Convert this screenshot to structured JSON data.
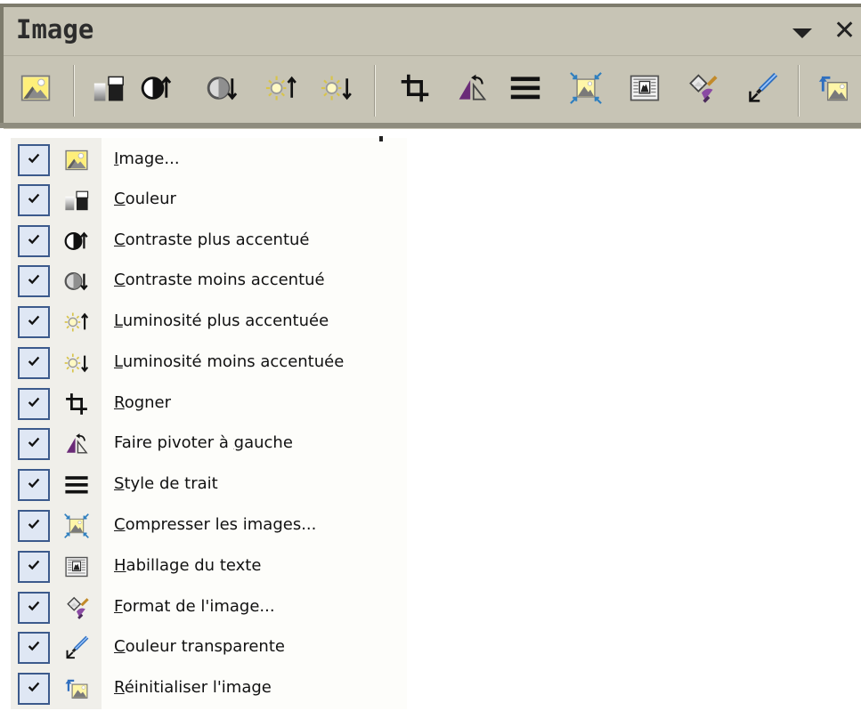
{
  "toolbar": {
    "title": "Image",
    "buttons": [
      {
        "name": "image-icon"
      },
      {
        "name": "color-icon"
      },
      {
        "name": "more-contrast-icon"
      },
      {
        "name": "less-contrast-icon"
      },
      {
        "name": "more-brightness-icon"
      },
      {
        "name": "less-brightness-icon"
      },
      {
        "name": "crop-icon"
      },
      {
        "name": "rotate-left-icon"
      },
      {
        "name": "line-style-icon"
      },
      {
        "name": "compress-images-icon"
      },
      {
        "name": "text-wrapping-icon"
      },
      {
        "name": "format-picture-icon"
      },
      {
        "name": "set-transparent-color-icon"
      },
      {
        "name": "reset-picture-icon"
      }
    ]
  },
  "menu": {
    "items": [
      {
        "mnemonic": "I",
        "rest": "mage...",
        "icon": "image-icon",
        "checked": true
      },
      {
        "mnemonic": "C",
        "rest": "ouleur",
        "icon": "color-icon",
        "checked": true
      },
      {
        "mnemonic": "C",
        "rest": "ontraste plus accentué",
        "icon": "more-contrast-icon",
        "checked": true
      },
      {
        "mnemonic": "C",
        "rest": "ontraste moins accentué",
        "icon": "less-contrast-icon",
        "checked": true
      },
      {
        "mnemonic": "L",
        "rest": "uminosité plus accentuée",
        "icon": "more-brightness-icon",
        "checked": true
      },
      {
        "mnemonic": "L",
        "rest": "uminosité moins accentuée",
        "icon": "less-brightness-icon",
        "checked": true
      },
      {
        "mnemonic": "R",
        "rest": "ogner",
        "icon": "crop-icon",
        "checked": true
      },
      {
        "prefix": "Faire pivoter à ",
        "mnemonic": "g",
        "rest": "auche",
        "icon": "rotate-left-icon",
        "checked": true
      },
      {
        "mnemonic": "S",
        "rest": "tyle de trait",
        "icon": "line-style-icon",
        "checked": true
      },
      {
        "mnemonic": "C",
        "rest": "ompresser les images...",
        "icon": "compress-images-icon",
        "checked": true
      },
      {
        "mnemonic": "H",
        "rest": "abillage du texte",
        "icon": "text-wrapping-icon",
        "checked": true
      },
      {
        "mnemonic": "F",
        "rest": "ormat de l'image...",
        "icon": "format-picture-icon",
        "checked": true
      },
      {
        "mnemonic": "C",
        "rest": "ouleur transparente",
        "icon": "set-transparent-color-icon",
        "checked": true
      },
      {
        "mnemonic": "R",
        "rest": "éinitialiser l'image",
        "icon": "reset-picture-icon",
        "checked": true
      }
    ]
  },
  "colors": {
    "toolbar_bg": "#c7c4b5",
    "check_border": "#3c5a8c",
    "check_bg": "#dfe7f4",
    "menu_strip": "#f0efea"
  }
}
